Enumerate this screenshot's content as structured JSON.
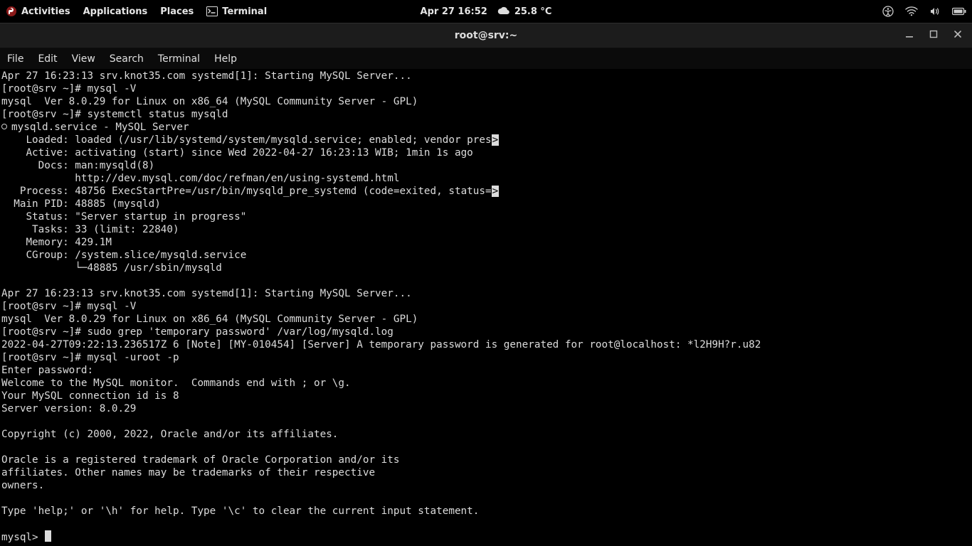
{
  "top_panel": {
    "activities": "Activities",
    "applications": "Applications",
    "places": "Places",
    "terminal": "Terminal",
    "datetime": "Apr 27  16:52",
    "temperature": "25.8 °C"
  },
  "window": {
    "title": "root@srv:~",
    "menus": [
      "File",
      "Edit",
      "View",
      "Search",
      "Terminal",
      "Help"
    ]
  },
  "term": {
    "l01": "Apr 27 16:23:13 srv.knot35.com systemd[1]: Starting MySQL Server...",
    "l02_prompt": "[root@srv ~]# ",
    "l02_cmd": "mysql -V",
    "l03": "mysql  Ver 8.0.29 for Linux on x86_64 (MySQL Community Server - GPL)",
    "l04_prompt": "[root@srv ~]# ",
    "l04_cmd": "systemctl status mysqld",
    "l05_svc": "mysqld.service - MySQL Server",
    "l06a": "    Loaded: loaded (/usr/lib/systemd/system/mysqld.service; enabled; vendor pres",
    "l06b": ">",
    "l07": "    Active: activating (start) since Wed 2022-04-27 16:23:13 WIB; 1min 1s ago",
    "l08": "      Docs: man:mysqld(8)",
    "l09": "            http://dev.mysql.com/doc/refman/en/using-systemd.html",
    "l10a": "   Process: 48756 ExecStartPre=/usr/bin/mysqld_pre_systemd (code=exited, status=",
    "l10b": ">",
    "l11": "  Main PID: 48885 (mysqld)",
    "l12": "    Status: \"Server startup in progress\"",
    "l13": "     Tasks: 33 (limit: 22840)",
    "l14": "    Memory: 429.1M",
    "l15": "    CGroup: /system.slice/mysqld.service",
    "l16": "            └─48885 /usr/sbin/mysqld",
    "l17": "",
    "l18": "Apr 27 16:23:13 srv.knot35.com systemd[1]: Starting MySQL Server...",
    "l19_prompt": "[root@srv ~]# ",
    "l19_cmd": "mysql -V",
    "l20": "mysql  Ver 8.0.29 for Linux on x86_64 (MySQL Community Server - GPL)",
    "l21_prompt": "[root@srv ~]# ",
    "l21_cmd": "sudo grep 'temporary password' /var/log/mysqld.log",
    "l22": "2022-04-27T09:22:13.236517Z 6 [Note] [MY-010454] [Server] A temporary password is generated for root@localhost: *l2H9H?r.u82",
    "l23_prompt": "[root@srv ~]# ",
    "l23_cmd": "mysql -uroot -p",
    "l24": "Enter password: ",
    "l25": "Welcome to the MySQL monitor.  Commands end with ; or \\g.",
    "l26": "Your MySQL connection id is 8",
    "l27": "Server version: 8.0.29",
    "l28": "",
    "l29": "Copyright (c) 2000, 2022, Oracle and/or its affiliates.",
    "l30": "",
    "l31": "Oracle is a registered trademark of Oracle Corporation and/or its",
    "l32": "affiliates. Other names may be trademarks of their respective",
    "l33": "owners.",
    "l34": "",
    "l35": "Type 'help;' or '\\h' for help. Type '\\c' to clear the current input statement.",
    "l36": "",
    "l37": "mysql> "
  }
}
